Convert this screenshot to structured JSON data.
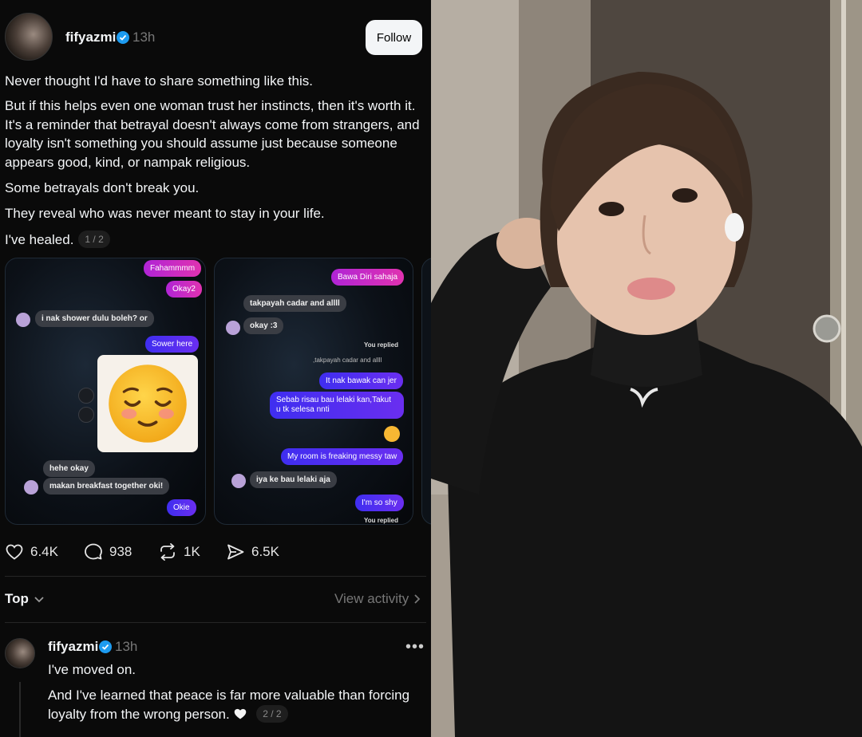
{
  "post": {
    "username": "fifyazmi",
    "time": "13h",
    "follow_label": "Follow",
    "paragraphs": [
      "Never thought I'd have to share something like this.",
      "But if this helps even one woman trust her instincts, then it's worth it. It's a reminder that betrayal doesn't always come from strangers, and loyalty isn't something you should assume just because someone appears good, kind, or nampak religious.",
      "Some betrayals don't break you.",
      "They reveal who was never meant to stay in your life."
    ],
    "last_line": "I've healed.",
    "pager": "1 / 2"
  },
  "chat1": {
    "b1": "Fahammmm",
    "b2": "Okay2",
    "b3": "i nak shower dulu boleh? or",
    "b4": "Sower here",
    "b5": "hehe okay",
    "b6": "makan breakfast together oki!",
    "b7": "Okie"
  },
  "chat2": {
    "b1": "Bawa Diri sahaja",
    "b2": "takpayah cadar and allll",
    "b3": "okay :3",
    "replied1": "You replied",
    "quote": ",takpayah cadar and allll",
    "b4": "It nak bawak can jer",
    "b5": "Sebab risau bau lelaki kan,Takut u tk selesa nnti",
    "b6": "My room is freaking messy taw",
    "b7": "iya ke bau lelaki aja",
    "b8": "I'm so shy",
    "replied2": "You replied"
  },
  "actions": {
    "likes": "6.4K",
    "comments": "938",
    "reposts": "1K",
    "shares": "6.5K"
  },
  "sort": {
    "label": "Top",
    "view_activity": "View activity"
  },
  "reply": {
    "username": "fifyazmi",
    "time": "13h",
    "more": "•••",
    "line1": "I've moved on.",
    "line2": "And I've learned that peace is far more valuable than forcing loyalty from the wrong person.",
    "pager": "2 / 2"
  },
  "icons": [
    "verified-badge-icon",
    "heart-icon",
    "comment-icon",
    "repost-icon",
    "share-icon",
    "chevron-down-icon",
    "chevron-right-icon",
    "more-icon",
    "white-heart-icon"
  ],
  "colors": {
    "accent": "#1d9bf0",
    "background": "#0a0a0a",
    "muted": "#777777"
  }
}
